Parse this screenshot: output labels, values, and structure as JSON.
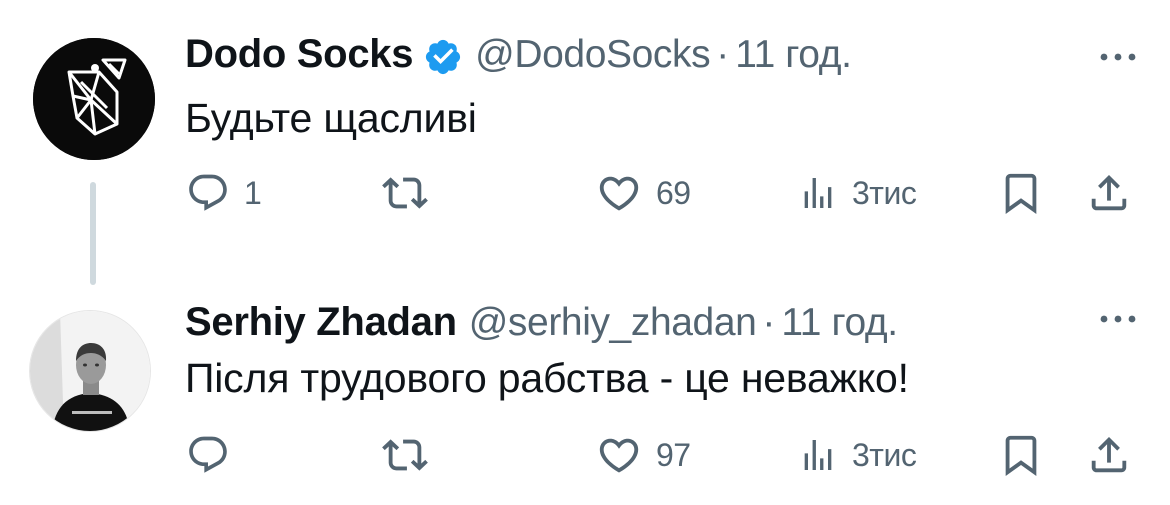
{
  "tweets": [
    {
      "display_name": "Dodo Socks",
      "verified": true,
      "handle": "@DodoSocks",
      "separator": "·",
      "time": "11 год.",
      "text": "Будьте щасливі",
      "replies": "1",
      "retweets": "",
      "likes": "69",
      "views": "3тис"
    },
    {
      "display_name": "Serhiy Zhadan",
      "verified": false,
      "handle": "@serhiy_zhadan",
      "separator": "·",
      "time": "11 год.",
      "text": "Після трудового рабства - це неважко!",
      "replies": "",
      "retweets": "",
      "likes": "97",
      "views": "3тис"
    }
  ],
  "colors": {
    "text_primary": "#0f1419",
    "text_secondary": "#536471",
    "verified_badge": "#1d9bf0",
    "thread_line": "#cfd9de"
  },
  "icons": [
    "more-icon",
    "reply-icon",
    "retweet-icon",
    "like-icon",
    "views-icon",
    "bookmark-icon",
    "share-icon",
    "verified-badge-icon"
  ]
}
